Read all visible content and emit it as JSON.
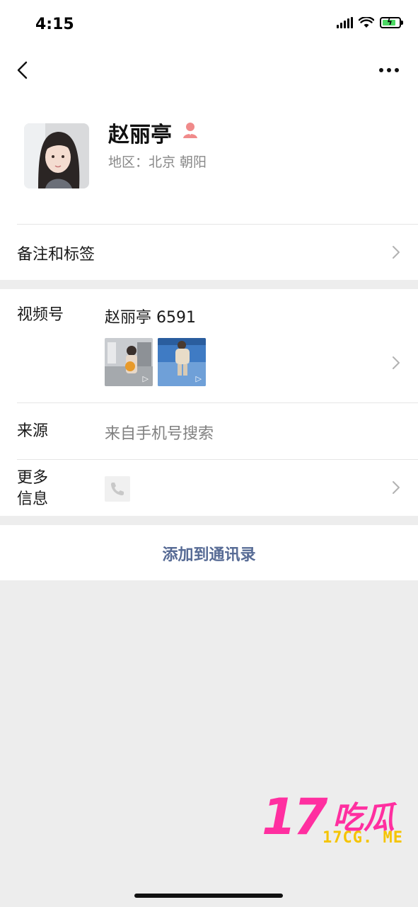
{
  "status_bar": {
    "time": "4:15"
  },
  "profile": {
    "name": "赵丽亭",
    "region": "地区：北京 朝阳"
  },
  "rows": {
    "note_label": "备注和标签",
    "video_label": "视频号",
    "video_account": "赵丽亭 6591",
    "source_label": "来源",
    "source_value": "来自手机号搜索",
    "more_label_line1": "更多",
    "more_label_line2": "信息"
  },
  "actions": {
    "add_contact": "添加到通讯录"
  },
  "watermark": {
    "number": "17",
    "chars": "吃瓜",
    "site": "17CG. ME"
  },
  "colors": {
    "link": "#576b95",
    "gender_icon": "#f08a8a",
    "watermark_pink": "#ff2fa0",
    "watermark_yellow": "#f5c400"
  },
  "icons": [
    "back-arrow-icon",
    "more-dots-icon",
    "gender-female-icon",
    "chevron-right-icon",
    "phone-icon",
    "play-icon"
  ]
}
